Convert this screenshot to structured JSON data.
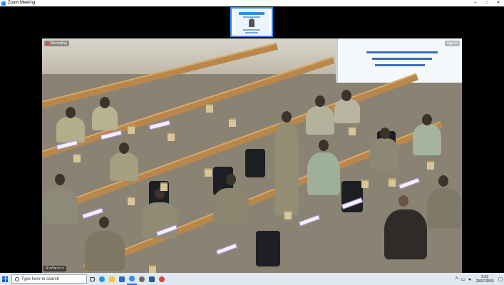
{
  "window": {
    "title": "Zoom Meeting",
    "controls": {
      "minimize": "–",
      "maximize": "□",
      "close": "✕"
    }
  },
  "video": {
    "recording_label": "Recording",
    "top_right_label": "Sign in",
    "speaker_name": "ฝ่ายวิชาการ"
  },
  "taskbar": {
    "search_placeholder": "Type here to search",
    "apps": [
      "task-view",
      "edge",
      "file-explorer",
      "mail",
      "zoom",
      "settings",
      "word",
      "chrome"
    ],
    "clock_time": "9:33",
    "clock_date": "23/07/2565"
  },
  "colors": {
    "zoom_blue": "#2d8cff",
    "taskbar_bg": "#dfe7ef"
  }
}
